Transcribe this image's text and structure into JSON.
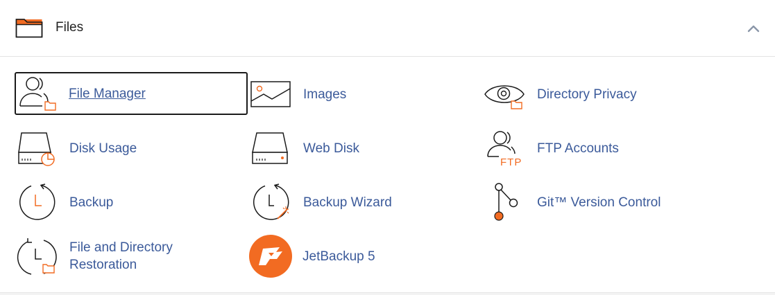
{
  "section": {
    "title": "Files",
    "icon": "folder-icon",
    "collapse_icon": "chevron-up-icon"
  },
  "colors": {
    "link": "#3b5a9a",
    "accent": "#f26b22",
    "icon_stroke": "#1a1a1a"
  },
  "items": [
    {
      "label": "File Manager",
      "icon": "file-manager-icon",
      "focused": true
    },
    {
      "label": "Images",
      "icon": "images-icon"
    },
    {
      "label": "Directory Privacy",
      "icon": "directory-privacy-icon"
    },
    {
      "label": "Disk Usage",
      "icon": "disk-usage-icon"
    },
    {
      "label": "Web Disk",
      "icon": "web-disk-icon"
    },
    {
      "label": "FTP Accounts",
      "icon": "ftp-accounts-icon",
      "icon_text": "FTP"
    },
    {
      "label": "Backup",
      "icon": "backup-icon"
    },
    {
      "label": "Backup Wizard",
      "icon": "backup-wizard-icon"
    },
    {
      "label": "Git™ Version Control",
      "icon": "git-icon"
    },
    {
      "label_line1": "File and Directory",
      "label_line2": "Restoration",
      "icon": "file-restoration-icon"
    },
    {
      "label": "JetBackup 5",
      "icon": "jetbackup-logo-icon"
    }
  ]
}
